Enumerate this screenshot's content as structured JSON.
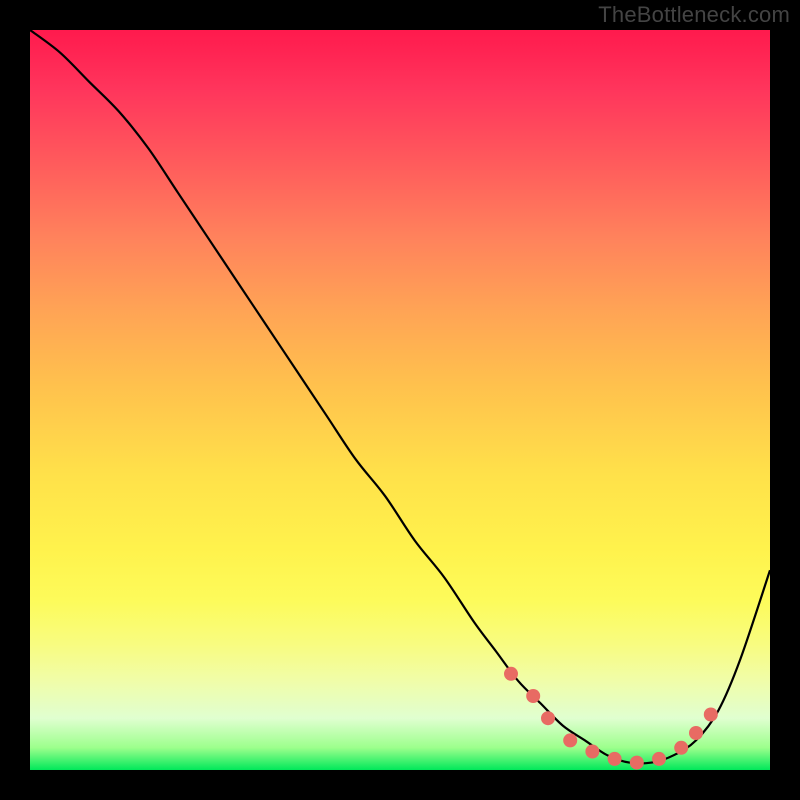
{
  "watermark": "TheBottleneck.com",
  "chart_data": {
    "type": "line",
    "title": "",
    "xlabel": "",
    "ylabel": "",
    "xlim": [
      0,
      100
    ],
    "ylim": [
      0,
      100
    ],
    "series": [
      {
        "name": "bottleneck-curve",
        "x": [
          0,
          4,
          8,
          12,
          16,
          20,
          24,
          28,
          32,
          36,
          40,
          44,
          48,
          52,
          56,
          60,
          63,
          66,
          69,
          72,
          75,
          78,
          81,
          84,
          87,
          90,
          93,
          96,
          100
        ],
        "y": [
          100,
          97,
          93,
          89,
          84,
          78,
          72,
          66,
          60,
          54,
          48,
          42,
          37,
          31,
          26,
          20,
          16,
          12,
          9,
          6,
          4,
          2,
          1,
          1,
          2,
          4,
          8,
          15,
          27
        ]
      }
    ],
    "dots": {
      "name": "highlighted-range",
      "color": "#e86b63",
      "points": [
        {
          "x": 65,
          "y": 13
        },
        {
          "x": 68,
          "y": 10
        },
        {
          "x": 70,
          "y": 7
        },
        {
          "x": 73,
          "y": 4
        },
        {
          "x": 76,
          "y": 2.5
        },
        {
          "x": 79,
          "y": 1.5
        },
        {
          "x": 82,
          "y": 1
        },
        {
          "x": 85,
          "y": 1.5
        },
        {
          "x": 88,
          "y": 3
        },
        {
          "x": 90,
          "y": 5
        },
        {
          "x": 92,
          "y": 7.5
        }
      ]
    }
  }
}
